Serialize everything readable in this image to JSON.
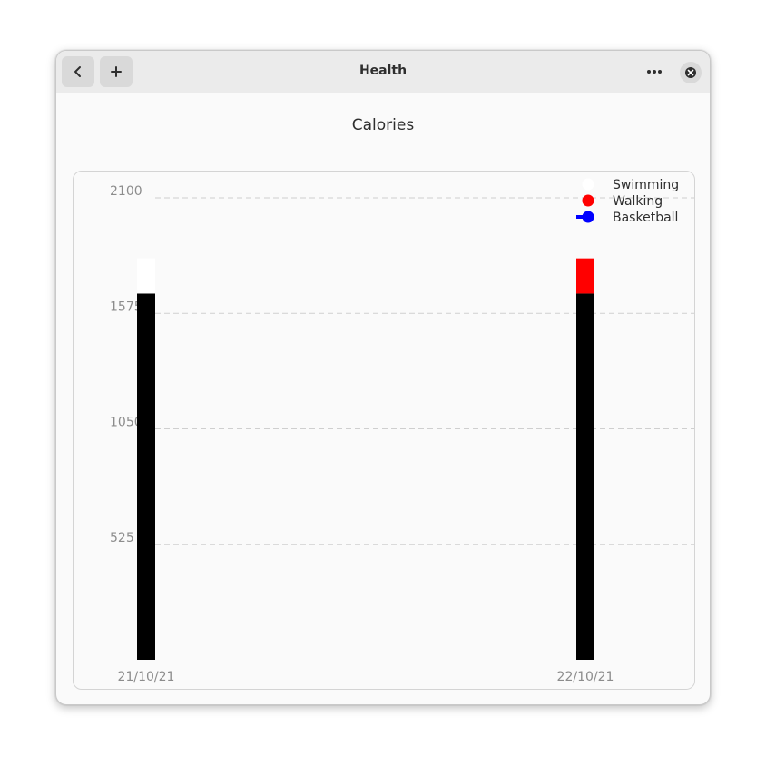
{
  "window": {
    "title": "Health"
  },
  "header": {
    "back_icon": "chevron-left-icon",
    "add_icon": "plus-icon",
    "menu_icon": "ellipsis-icon",
    "close_icon": "close-icon"
  },
  "page": {
    "chart_title": "Calories"
  },
  "chart_data": {
    "type": "bar",
    "stacked": true,
    "categories": [
      "21/10/21",
      "22/10/21"
    ],
    "series": [
      {
        "name": "Basketball",
        "color": "#000000",
        "values": [
          1665,
          1665
        ]
      },
      {
        "name": "Walking",
        "color": "#ff0000",
        "values": [
          0,
          160
        ]
      },
      {
        "name": "Swimming",
        "color": "#ffffff",
        "values": [
          160,
          0
        ]
      }
    ],
    "legend_order": [
      "Swimming",
      "Walking",
      "Basketball"
    ],
    "legend_colors": {
      "Swimming": "#ffffff",
      "Walking": "#ff0000",
      "Basketball": "#0000ff"
    },
    "yticks": [
      "525",
      "1050",
      "1575",
      "2100"
    ],
    "ytick_values": [
      525,
      1050,
      1575,
      2100
    ],
    "ylim": [
      0,
      2100
    ],
    "grid": true,
    "legend_placement": "top-right"
  }
}
